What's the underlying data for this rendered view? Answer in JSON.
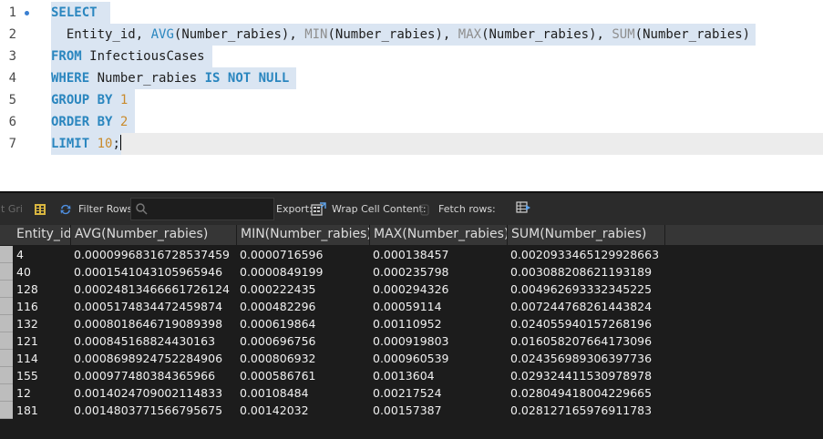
{
  "editor": {
    "lines": [
      {
        "num": "1"
      },
      {
        "num": "2"
      },
      {
        "num": "3"
      },
      {
        "num": "4"
      },
      {
        "num": "5"
      },
      {
        "num": "6"
      },
      {
        "num": "7"
      }
    ],
    "tokens": {
      "select": "SELECT",
      "entity_id": "Entity_id,",
      "avg": "AVG",
      "avg_arg": "(Number_rabies),",
      "min": "MIN",
      "min_arg": "(Number_rabies),",
      "max": "MAX",
      "max_arg": "(Number_rabies),",
      "sum": "SUM",
      "sum_arg": "(Number_rabies)",
      "from": "FROM",
      "table": "InfectiousCases",
      "where": "WHERE",
      "where_col": "Number_rabies",
      "is_not_null": "IS NOT NULL",
      "group_by": "GROUP BY",
      "group_val": "1",
      "order_by": "ORDER BY",
      "order_val": "2",
      "limit": "LIMIT",
      "limit_val": "10",
      "semicolon": ";"
    }
  },
  "toolbar": {
    "result_grid_label": "lt Gri",
    "filter_rows_label": "Filter Rows:",
    "filter_rows_value": "",
    "export_label": "Export:",
    "wrap_label": "Wrap Cell Content:",
    "fetch_label": "Fetch rows:"
  },
  "grid": {
    "columns": [
      "Entity_id",
      "AVG(Number_rabies)",
      "MIN(Number_rabies)",
      "MAX(Number_rabies)",
      "SUM(Number_rabies)"
    ],
    "rows": [
      [
        "4",
        "0.00009968316728537459",
        "0.0000716596",
        "0.000138457",
        "0.0020933465129928663"
      ],
      [
        "40",
        "0.0001541043105965946",
        "0.0000849199",
        "0.000235798",
        "0.003088208621193189"
      ],
      [
        "128",
        "0.0002481346666172612​4",
        "0.000222435",
        "0.000294326",
        "0.004962693332345225"
      ],
      [
        "116",
        "0.0005174834472459874",
        "0.000482296",
        "0.00059114",
        "0.007244768261443824"
      ],
      [
        "132",
        "0.0008018646719089398",
        "0.000619864",
        "0.00110952",
        "0.024055940157268196"
      ],
      [
        "121",
        "0.000845168824430163",
        "0.000696756",
        "0.000919803",
        "0.016058207664173096"
      ],
      [
        "114",
        "0.0008698924752284906",
        "0.000806932",
        "0.000960539",
        "0.024356989306397736"
      ],
      [
        "155",
        "0.0009774803843659​66",
        "0.000586761",
        "0.0013604",
        "0.029324411530978978"
      ],
      [
        "12",
        "0.0014024709002114833",
        "0.00108484",
        "0.00217524",
        "0.028049418004229665"
      ],
      [
        "181",
        "0.0014803771566795675",
        "0.00142032",
        "0.00157387",
        "0.028127165976911783"
      ]
    ]
  }
}
